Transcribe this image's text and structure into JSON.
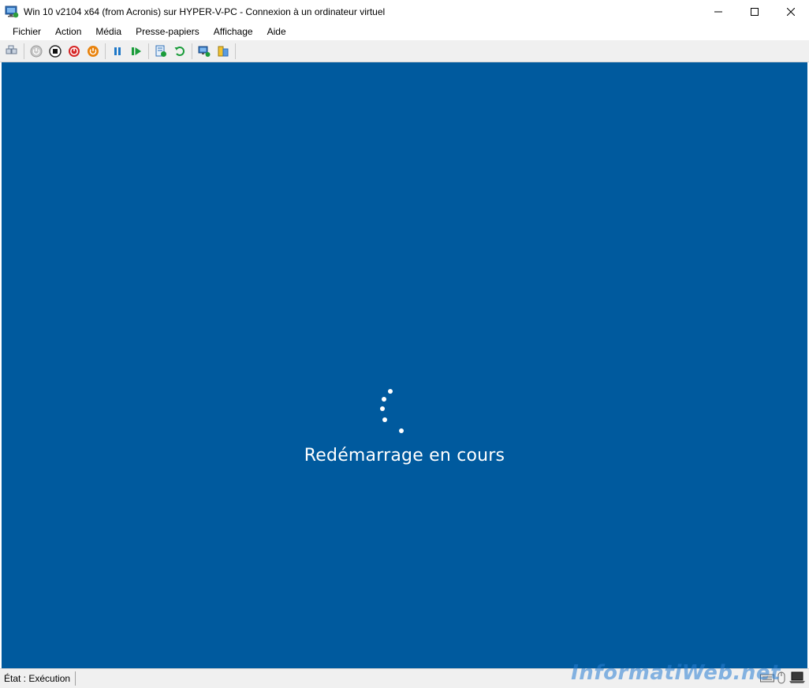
{
  "window": {
    "title": "Win 10 v2104 x64 (from Acronis) sur HYPER-V-PC - Connexion à un ordinateur virtuel",
    "icon": "vm-connection-icon"
  },
  "menu": {
    "items": [
      "Fichier",
      "Action",
      "Média",
      "Presse-papiers",
      "Affichage",
      "Aide"
    ]
  },
  "toolbar": {
    "buttons": [
      "ctrl-alt-del-icon",
      "start-icon",
      "turn-off-icon",
      "shut-down-icon",
      "save-icon",
      "pause-icon",
      "reset-icon",
      "checkpoint-icon",
      "revert-icon",
      "enhanced-session-icon",
      "share-icon"
    ]
  },
  "vm": {
    "background_color": "#005a9e",
    "message": "Redémarrage en cours"
  },
  "status": {
    "text": "État : Exécution"
  },
  "watermark": {
    "text": "InformatiWeb.net"
  },
  "colors": {
    "vm_blue": "#005a9e",
    "play_green": "#1a9c3a",
    "stop_red": "#d62525",
    "power_orange": "#e8820c",
    "pause_blue": "#1e78c8"
  }
}
